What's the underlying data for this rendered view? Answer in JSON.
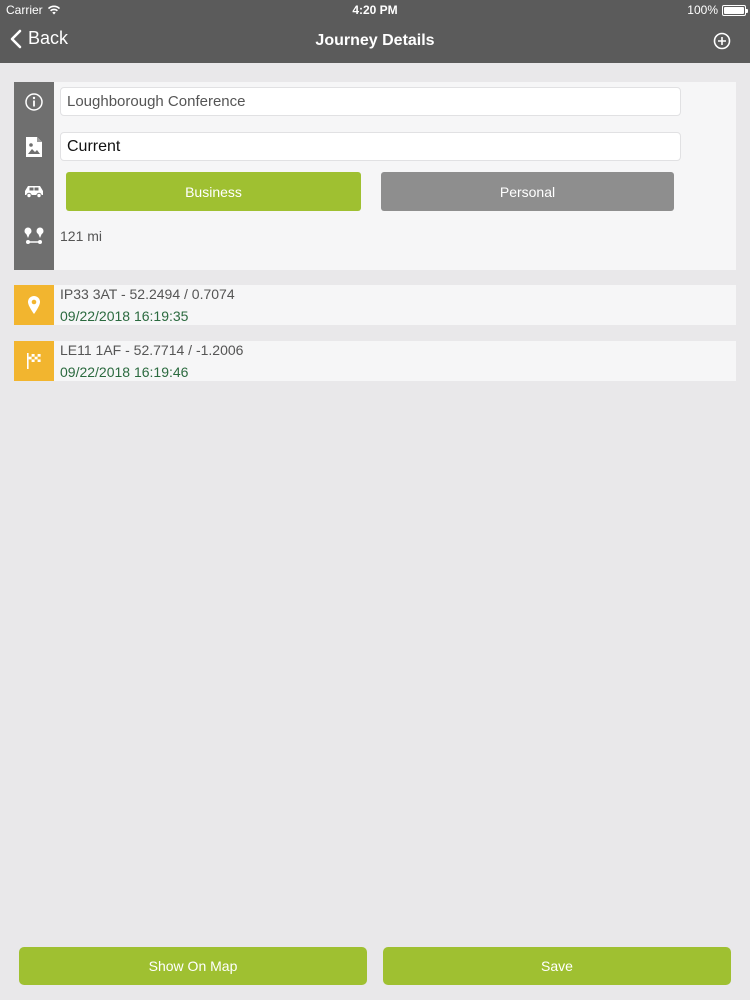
{
  "status_bar": {
    "carrier": "Carrier",
    "time": "4:20 PM",
    "battery": "100%"
  },
  "nav": {
    "back_label": "Back",
    "title": "Journey Details",
    "add_icon": "plus-circle-icon"
  },
  "details": {
    "journey_name": "Loughborough Conference",
    "category": "Current",
    "type_options": [
      "Business",
      "Personal"
    ],
    "selected_type": "Business",
    "distance": "121 mi",
    "icons": [
      "info-icon",
      "document-image-icon",
      "car-icon",
      "route-icon"
    ]
  },
  "locations": [
    {
      "icon": "map-pin-icon",
      "place": "IP33 3AT - 52.2494 / 0.7074",
      "timestamp": "09/22/2018 16:19:35"
    },
    {
      "icon": "finish-flag-icon",
      "place": "LE11 1AF - 52.7714 / -1.2006",
      "timestamp": "09/22/2018 16:19:46"
    }
  ],
  "actions": {
    "show_on_map": "Show On Map",
    "save": "Save"
  },
  "colors": {
    "bar": "#5b5b5b",
    "accent_green": "#9fc031",
    "inactive_gray": "#8e8e8e",
    "location_yellow": "#f2b52f",
    "timestamp_green": "#2b6a3f"
  }
}
